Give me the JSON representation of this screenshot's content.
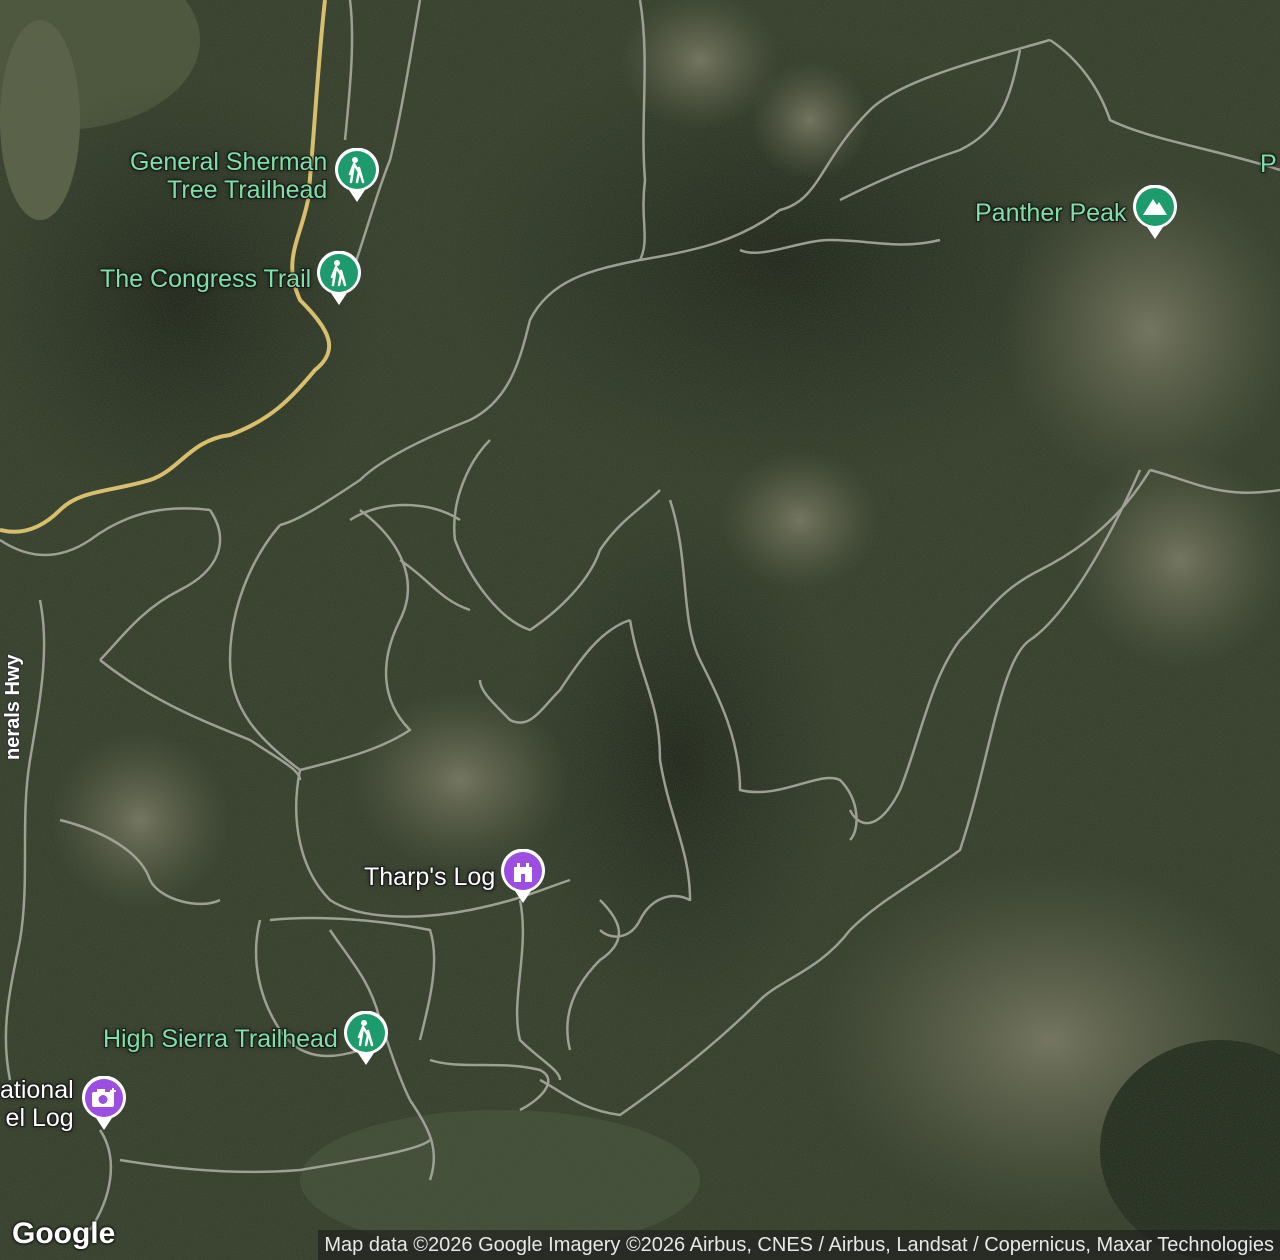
{
  "map": {
    "type": "satellite",
    "pois": [
      {
        "name": "General Sherman\nTree Trailhead",
        "line1": "General Sherman",
        "line2": "Tree Trailhead",
        "icon": "hiking-icon",
        "color": "#1e9b6c"
      },
      {
        "name": "The Congress Trail",
        "icon": "hiking-icon",
        "color": "#1e9b6c"
      },
      {
        "name": "Panther Peak",
        "icon": "mountain-icon",
        "color": "#1e9b6c"
      },
      {
        "name": "Tharp's Log",
        "icon": "castle-icon",
        "color": "#9c4ee0"
      },
      {
        "name": "High Sierra Trailhead",
        "icon": "hiking-icon",
        "color": "#1e9b6c"
      },
      {
        "name": "ational\nel Log",
        "line1": "ational",
        "line2": "el Log",
        "icon": "camera-icon",
        "color": "#9c4ee0"
      }
    ],
    "partial_label_right": "P",
    "road_label": "nerals Hwy",
    "logo": "Google",
    "attribution": "Map data ©2026 Google Imagery ©2026 Airbus, CNES / Airbus, Landsat / Copernicus, Maxar Technologies"
  }
}
